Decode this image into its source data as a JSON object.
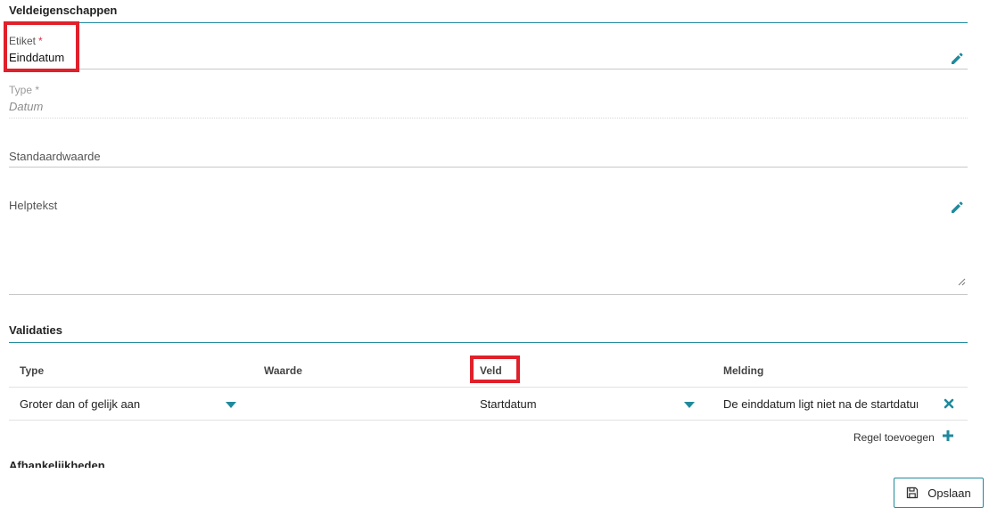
{
  "field_properties": {
    "title": "Veldeigenschappen",
    "label_field": {
      "label": "Etiket",
      "required_mark": "*",
      "value": "Einddatum"
    },
    "type_field": {
      "label": "Type *",
      "value": "Datum"
    },
    "default_field": {
      "label": "Standaardwaarde"
    },
    "help_field": {
      "label": "Helptekst"
    }
  },
  "validations": {
    "title": "Validaties",
    "columns": [
      "Type",
      "Waarde",
      "Veld",
      "Melding"
    ],
    "rows": [
      {
        "type": "Groter dan of gelijk aan",
        "value": "",
        "field": "Startdatum",
        "message": "De einddatum ligt niet na de startdatum"
      }
    ],
    "add_rule_label": "Regel toevoegen"
  },
  "dependencies": {
    "title": "Afhankelijkheden"
  },
  "footer": {
    "save_label": "Opslaan"
  },
  "colors": {
    "accent": "#1f8a9c",
    "required": "#d9304b",
    "highlight": "#e0202a"
  },
  "icons": [
    "pencil-icon",
    "chevron-down-icon",
    "close-icon",
    "plus-icon",
    "save-icon"
  ]
}
